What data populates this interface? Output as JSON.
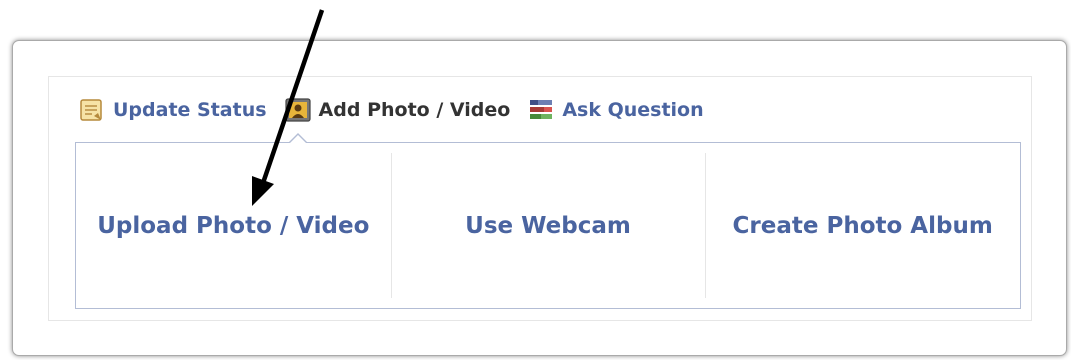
{
  "composer": {
    "tabs": [
      {
        "label": "Update Status",
        "icon": "status-note-icon",
        "active": false
      },
      {
        "label": "Add Photo / Video",
        "icon": "photo-icon",
        "active": true
      },
      {
        "label": "Ask Question",
        "icon": "question-list-icon",
        "active": false
      }
    ],
    "options": [
      {
        "label": "Upload Photo / Video"
      },
      {
        "label": "Use Webcam"
      },
      {
        "label": "Create Photo Album"
      }
    ]
  },
  "colors": {
    "link_blue": "#4a64a0",
    "active_text": "#333333",
    "panel_border": "#b3bdd5"
  }
}
